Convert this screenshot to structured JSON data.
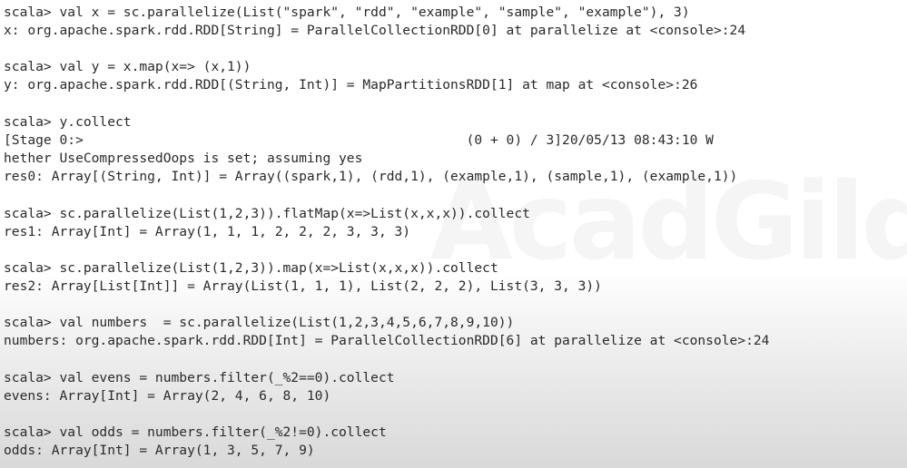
{
  "terminal": {
    "blocks": [
      {
        "lines": [
          "scala> val x = sc.parallelize(List(\"spark\", \"rdd\", \"example\", \"sample\", \"example\"), 3)",
          "x: org.apache.spark.rdd.RDD[String] = ParallelCollectionRDD[0] at parallelize at <console>:24"
        ]
      },
      {
        "lines": [
          "scala> val y = x.map(x=> (x,1))",
          "y: org.apache.spark.rdd.RDD[(String, Int)] = MapPartitionsRDD[1] at map at <console>:26"
        ]
      },
      {
        "lines": [
          "scala> y.collect",
          "[Stage 0:>                                                (0 + 0) / 3]20/05/13 08:43:10 W",
          "hether UseCompressedOops is set; assuming yes",
          "res0: Array[(String, Int)] = Array((spark,1), (rdd,1), (example,1), (sample,1), (example,1))"
        ]
      },
      {
        "lines": [
          "scala> sc.parallelize(List(1,2,3)).flatMap(x=>List(x,x,x)).collect",
          "res1: Array[Int] = Array(1, 1, 1, 2, 2, 2, 3, 3, 3)"
        ]
      },
      {
        "lines": [
          "scala> sc.parallelize(List(1,2,3)).map(x=>List(x,x,x)).collect",
          "res2: Array[List[Int]] = Array(List(1, 1, 1), List(2, 2, 2), List(3, 3, 3))"
        ]
      },
      {
        "lines": [
          "scala> val numbers  = sc.parallelize(List(1,2,3,4,5,6,7,8,9,10))",
          "numbers: org.apache.spark.rdd.RDD[Int] = ParallelCollectionRDD[6] at parallelize at <console>:24"
        ]
      },
      {
        "lines": [
          "scala> val evens = numbers.filter(_%2==0).collect",
          "evens: Array[Int] = Array(2, 4, 6, 8, 10)"
        ]
      },
      {
        "lines": [
          "scala> val odds = numbers.filter(_%2!=0).collect",
          "odds: Array[Int] = Array(1, 3, 5, 7, 9)"
        ]
      }
    ]
  }
}
